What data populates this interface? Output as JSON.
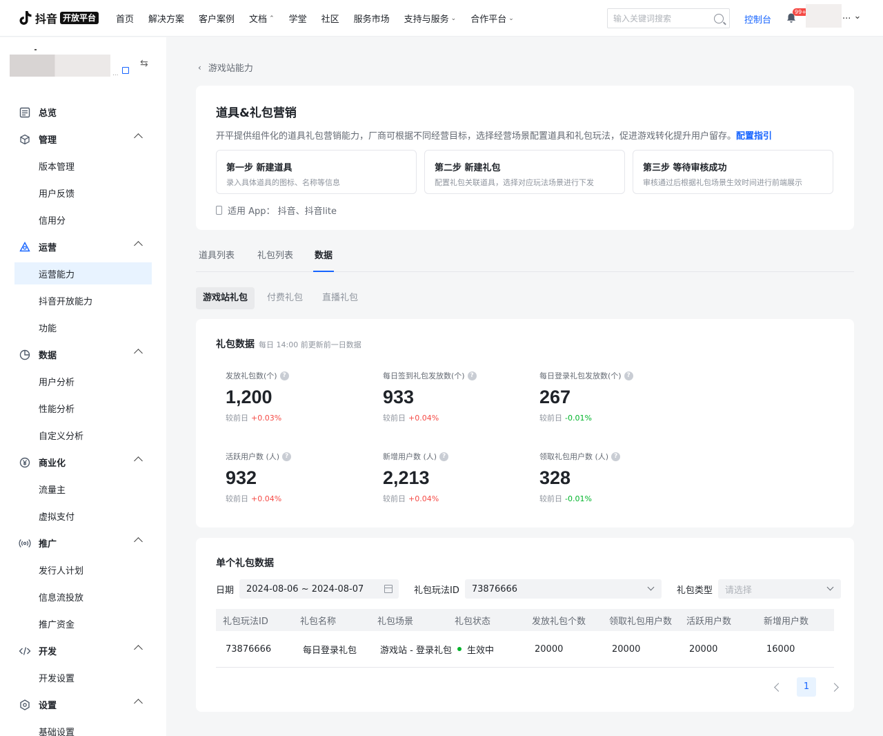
{
  "header": {
    "logo_text": "抖音",
    "logo_badge": "开放平台",
    "nav": [
      {
        "label": "首页",
        "chevron": false
      },
      {
        "label": "解决方案",
        "chevron": false
      },
      {
        "label": "客户案例",
        "chevron": false
      },
      {
        "label": "文档",
        "chevron": true
      },
      {
        "label": "学堂",
        "chevron": false
      },
      {
        "label": "社区",
        "chevron": false
      },
      {
        "label": "服务市场",
        "chevron": false
      },
      {
        "label": "支持与服务",
        "chevron": true
      },
      {
        "label": "合作平台",
        "chevron": true
      }
    ],
    "search_placeholder": "输入关键词搜索",
    "console": "控制台",
    "notification_count": "99+",
    "user_more": "... ⌄"
  },
  "sidebar": {
    "app_dots": "...",
    "groups": [
      {
        "label": "总览",
        "icon": "overview-icon",
        "collapsible": false,
        "items": []
      },
      {
        "label": "管理",
        "icon": "cube-icon",
        "collapsible": true,
        "items": [
          "版本管理",
          "用户反馈",
          "信用分"
        ]
      },
      {
        "label": "运营",
        "icon": "operate-icon",
        "collapsible": true,
        "items": [
          "运营能力",
          "抖音开放能力",
          "功能"
        ],
        "active": "运营能力"
      },
      {
        "label": "数据",
        "icon": "pie-icon",
        "collapsible": true,
        "items": [
          "用户分析",
          "性能分析",
          "自定义分析"
        ]
      },
      {
        "label": "商业化",
        "icon": "yuan-icon",
        "collapsible": true,
        "items": [
          "流量主",
          "虚拟支付"
        ]
      },
      {
        "label": "推广",
        "icon": "broadcast-icon",
        "collapsible": true,
        "items": [
          "发行人计划",
          "信息流投放",
          "推广资金"
        ]
      },
      {
        "label": "开发",
        "icon": "code-icon",
        "collapsible": true,
        "items": [
          "开发设置"
        ]
      },
      {
        "label": "设置",
        "icon": "settings-icon",
        "collapsible": true,
        "items": [
          "基础设置"
        ]
      }
    ]
  },
  "breadcrumb": {
    "back": "游戏站能力"
  },
  "intro": {
    "title": "道具&礼包营销",
    "desc": "开平提供组件化的道具礼包营销能力，厂商可根据不同经营目标，选择经营场景配置道具和礼包玩法，促进游戏转化提升用户留存。",
    "guide_link": "配置指引",
    "steps": [
      {
        "title": "第一步 新建道具",
        "sub": "录入具体道具的图标、名称等信息"
      },
      {
        "title": "第二步 新建礼包",
        "sub": "配置礼包关联道具，选择对应玩法场景进行下发"
      },
      {
        "title": "第三步 等待审核成功",
        "sub": "审核通过后根据礼包场景生效时间进行前端展示"
      }
    ],
    "app_line": "适用 App： 抖音、抖音lite"
  },
  "tabs": [
    {
      "label": "道具列表",
      "active": false
    },
    {
      "label": "礼包列表",
      "active": false
    },
    {
      "label": "数据",
      "active": true
    }
  ],
  "subtabs": [
    {
      "label": "游戏站礼包",
      "active": true
    },
    {
      "label": "付费礼包",
      "active": false
    },
    {
      "label": "直播礼包",
      "active": false
    }
  ],
  "stats": {
    "title": "礼包数据",
    "hint": "每日 14:00 前更新前一日数据",
    "compare_label": "较前日",
    "metrics": [
      {
        "label": "发放礼包数(个)",
        "value": "1,200",
        "delta": "+0.03%",
        "trend": "up"
      },
      {
        "label": "每日签到礼包发放数(个)",
        "value": "933",
        "delta": "+0.04%",
        "trend": "up"
      },
      {
        "label": "每日登录礼包发放数(个)",
        "value": "267",
        "delta": "-0.01%",
        "trend": "down"
      },
      {
        "label": "活跃用户数 (人)",
        "value": "932",
        "delta": "+0.04%",
        "trend": "up"
      },
      {
        "label": "新增用户数 (人)",
        "value": "2,213",
        "delta": "+0.04%",
        "trend": "up"
      },
      {
        "label": "领取礼包用户数 (人)",
        "value": "328",
        "delta": "-0.01%",
        "trend": "down"
      }
    ]
  },
  "single": {
    "title": "单个礼包数据",
    "date_label": "日期",
    "date_value": "2024-08-06 ~ 2024-08-07",
    "play_id_label": "礼包玩法ID",
    "play_id_value": "73876666",
    "type_label": "礼包类型",
    "type_placeholder": "请选择",
    "columns": [
      "礼包玩法ID",
      "礼包名称",
      "礼包场景",
      "礼包状态",
      "发放礼包个数",
      "领取礼包用户数",
      "活跃用户数",
      "新增用户数"
    ],
    "rows": [
      {
        "id": "73876666",
        "name": "每日登录礼包",
        "scene": "游戏站 - 登录礼包",
        "status": "生效中",
        "issued": "20000",
        "claimed": "20000",
        "active": "20000",
        "new": "16000"
      }
    ],
    "page": "1"
  },
  "colors": {
    "accent": "#1664ff",
    "up": "#f54a45",
    "down": "#00b42a"
  }
}
